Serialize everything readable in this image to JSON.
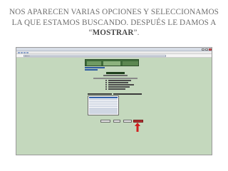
{
  "slide": {
    "title_part1": "Nos aparecen varias opciones y seleccionamos la que estamos buscando. Después le damos a “",
    "title_emphasis": "Mostrar",
    "title_part2": "”."
  },
  "browser": {
    "window_title": "",
    "address": "http://..."
  },
  "colors": {
    "page_background": "#c4d8bd",
    "banner": "#3f6b3a",
    "highlight_arrow": "#d11f1f",
    "selected_item": "#2f5fa8"
  },
  "icons": [
    "arrow-up-icon",
    "close-icon"
  ]
}
